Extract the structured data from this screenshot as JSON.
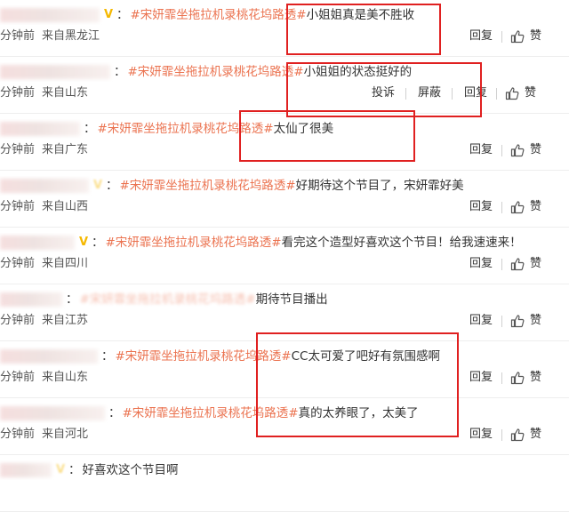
{
  "actions": {
    "report": "投诉",
    "block": "屏蔽",
    "reply": "回复",
    "like": "赞"
  },
  "comments": [
    {
      "vip": true,
      "topic": "#宋妍霏坐拖拉机录桃花坞路透#",
      "text": "小姐姐真是美不胜收",
      "time": "分钟前",
      "location": "来自黑龙江",
      "show_report": false
    },
    {
      "vip": false,
      "topic": "#宋妍霏坐拖拉机录桃花坞路透#",
      "text": "小姐姐的状态挺好的",
      "time": "分钟前",
      "location": "来自山东",
      "show_report": true
    },
    {
      "vip": false,
      "topic": "#宋妍霏坐拖拉机录桃花坞路透#",
      "text": "太仙了很美",
      "time": "分钟前",
      "location": "来自广东",
      "show_report": false
    },
    {
      "vip": true,
      "topic": "#宋妍霏坐拖拉机录桃花坞路透#",
      "text": "好期待这个节目了，宋妍霏好美",
      "time": "分钟前",
      "location": "来自山西",
      "show_report": false
    },
    {
      "vip": true,
      "topic": "#宋妍霏坐拖拉机录桃花坞路透#",
      "text": "看完这个造型好喜欢这个节目！给我速速来！",
      "time": "分钟前",
      "location": "来自四川",
      "show_report": false
    },
    {
      "vip": false,
      "topic": "#宋妍霏坐拖拉机录桃花坞路透#",
      "text": "期待节目播出",
      "time": "分钟前",
      "location": "来自江苏",
      "show_report": false
    },
    {
      "vip": false,
      "topic": "#宋妍霏坐拖拉机录桃花坞路透#",
      "text": "CC太可爱了吧好有氛围感啊",
      "time": "分钟前",
      "location": "来自山东",
      "show_report": false
    },
    {
      "vip": false,
      "topic": "#宋妍霏坐拖拉机录桃花坞路透#",
      "text": "真的太养眼了，太美了",
      "time": "分钟前",
      "location": "来自河北",
      "show_report": false
    },
    {
      "vip": true,
      "topic": "",
      "text": "好喜欢这个节目啊",
      "time": "",
      "location": "",
      "show_report": false
    }
  ]
}
